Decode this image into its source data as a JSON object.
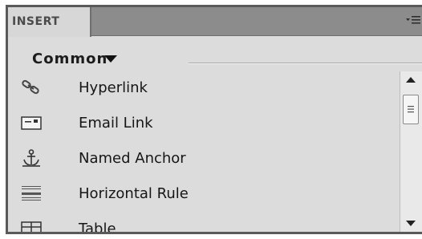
{
  "panel": {
    "tab_label": "INSERT",
    "category": "Common",
    "items": [
      {
        "label": "Hyperlink",
        "icon": "hyperlink-icon"
      },
      {
        "label": "Email Link",
        "icon": "email-link-icon"
      },
      {
        "label": "Named Anchor",
        "icon": "named-anchor-icon"
      },
      {
        "label": "Horizontal Rule",
        "icon": "horizontal-rule-icon"
      },
      {
        "label": "Table",
        "icon": "table-icon"
      }
    ]
  }
}
